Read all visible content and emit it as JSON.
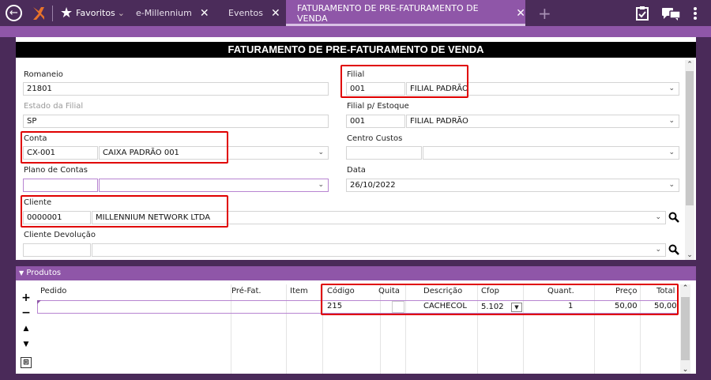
{
  "topbar": {
    "favorites_label": "Favoritos",
    "favorites_caret": "⌄",
    "tabs": [
      {
        "label": "e-Millennium"
      },
      {
        "label": "Eventos"
      },
      {
        "label": "FATURAMENTO DE PRE-FATURAMENTO DE VENDA"
      }
    ],
    "add_tab": "+",
    "close": "✕"
  },
  "form": {
    "title": "FATURAMENTO DE PRE-FATURAMENTO DE VENDA",
    "romaneio": {
      "label": "Romaneio",
      "value": "21801"
    },
    "estado_filial": {
      "label": "Estado da Filial",
      "value": "SP"
    },
    "conta": {
      "label": "Conta",
      "code": "CX-001",
      "name": "CAIXA PADRÃO 001"
    },
    "plano_contas": {
      "label": "Plano de Contas",
      "code": "",
      "name": ""
    },
    "cliente": {
      "label": "Cliente",
      "code": "0000001",
      "name": "MILLENNIUM NETWORK LTDA"
    },
    "cliente_devolucao": {
      "label": "Cliente Devolução",
      "code": "",
      "name": ""
    },
    "filial": {
      "label": "Filial",
      "code": "001",
      "name": "FILIAL PADRÃO"
    },
    "filial_estoque": {
      "label": "Filial p/ Estoque",
      "code": "001",
      "name": "FILIAL PADRÃO"
    },
    "centro_custos": {
      "label": "Centro Custos",
      "code": "",
      "name": ""
    },
    "data": {
      "label": "Data",
      "value": "26/10/2022"
    }
  },
  "produtos": {
    "header": "Produtos",
    "side": {
      "add": "+",
      "remove": "−",
      "up": "▲",
      "down": "▼"
    },
    "columns": {
      "pedido": "Pedido",
      "prefat": "Pré-Fat.",
      "item": "Item",
      "codigo": "Código",
      "quita": "Quita",
      "descricao": "Descrição",
      "cfop": "Cfop",
      "quant": "Quant.",
      "preco": "Preço",
      "total": "Total"
    },
    "row": {
      "codigo": "215",
      "descricao": "CACHECOL",
      "cfop": "5.102",
      "quant": "1",
      "preco": "50,00",
      "total": "50,00"
    }
  },
  "colors": {
    "topbar": "#4b2c5a",
    "accent": "#8f56a8",
    "highlight": "#e00000"
  }
}
